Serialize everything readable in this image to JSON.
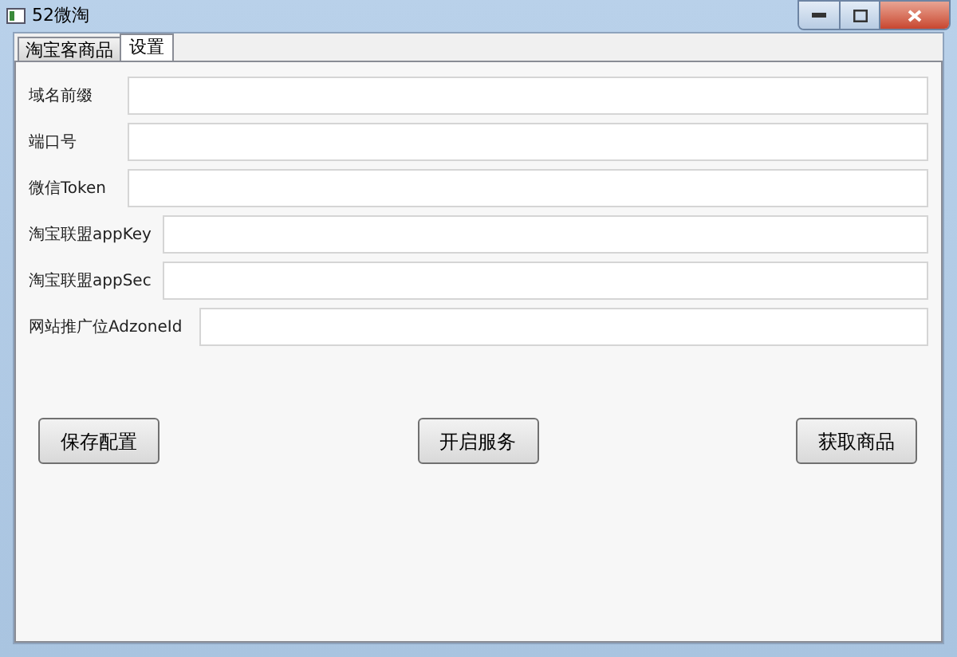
{
  "window": {
    "title": "52微淘"
  },
  "tabs": [
    {
      "label": "淘宝客商品",
      "selected": false
    },
    {
      "label": "设置",
      "selected": true
    }
  ],
  "fields": [
    {
      "label": "域名前缀"
    },
    {
      "label": "端口号"
    },
    {
      "label": "微信Token"
    },
    {
      "label": "淘宝联盟appKey"
    },
    {
      "label": "淘宝联盟appSec"
    },
    {
      "label": "网站推广位AdzoneId"
    }
  ],
  "buttons": [
    "保存配置",
    "开启服务",
    "获取商品"
  ]
}
